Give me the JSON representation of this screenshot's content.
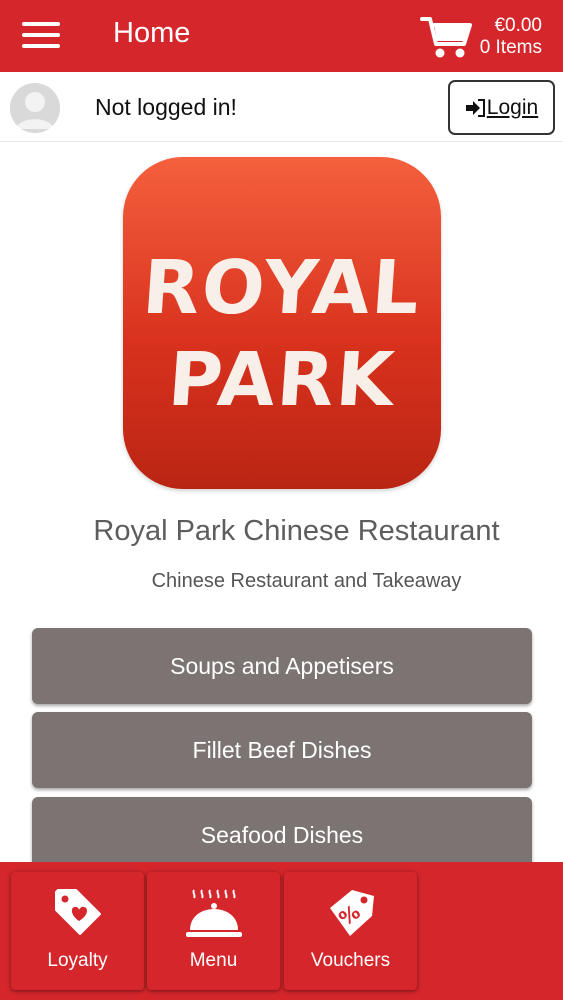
{
  "header": {
    "title": "Home",
    "cart_amount": "€0.00",
    "cart_items": "0 Items",
    "menu_icon": "hamburger-icon",
    "cart_icon": "cart-icon"
  },
  "user": {
    "status": "Not logged in!",
    "login_label": "Login",
    "login_icon": "sign-in-icon",
    "avatar_icon": "avatar-placeholder-icon"
  },
  "logo": {
    "line1": "ROYAL",
    "line2": "PARK"
  },
  "restaurant": {
    "name": "Royal Park Chinese Restaurant",
    "subtitle": "Chinese Restaurant and Takeaway"
  },
  "categories": [
    {
      "label": "Soups and Appetisers"
    },
    {
      "label": "Fillet Beef Dishes"
    },
    {
      "label": "Seafood Dishes"
    }
  ],
  "bottom_nav": [
    {
      "label": "Loyalty",
      "icon": "heart-tag-icon"
    },
    {
      "label": "Menu",
      "icon": "cloche-icon"
    },
    {
      "label": "Vouchers",
      "icon": "percent-tag-icon"
    }
  ],
  "colors": {
    "brand_red": "#d5262b",
    "category_gray": "#7b7472",
    "logo_orange": "#f4603d"
  }
}
